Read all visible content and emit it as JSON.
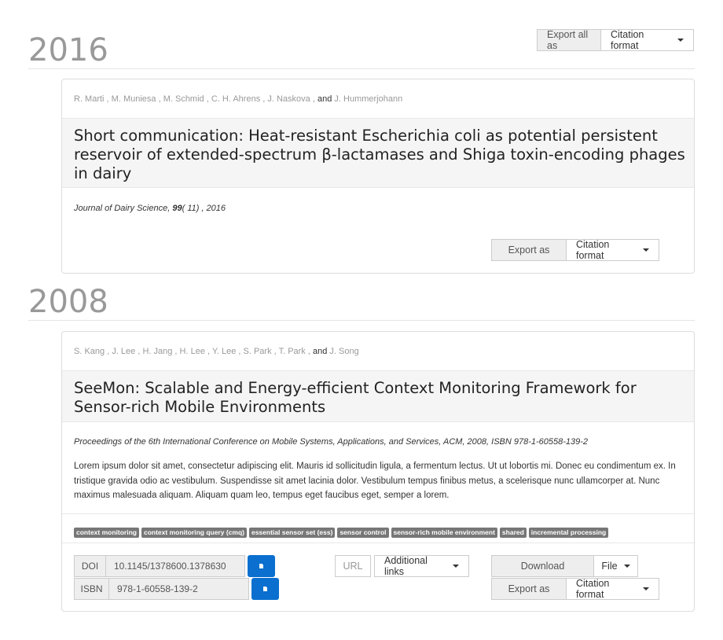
{
  "header": {
    "year": "2016",
    "export_all_label": "Export all as",
    "citation_format_label": "Citation format"
  },
  "pub1": {
    "authors": [
      "R. Marti",
      "M. Muniesa",
      "M. Schmid",
      "C. H. Ahrens",
      "J. Naskova"
    ],
    "and": "and",
    "last_author": "J. Hummerjohann",
    "title": "Short communication: Heat-resistant Escherichia coli as potential persistent reservoir of extended-spectrum β-lactamases and Shiga toxin-encoding phages in dairy",
    "journal": "Journal of Dairy Science,",
    "volume": "99",
    "issue_year": "( 11) , 2016",
    "export_label": "Export as",
    "citation_format_label": "Citation format"
  },
  "year2": "2008",
  "pub2": {
    "authors": [
      "S. Kang",
      "J. Lee",
      "H. Jang",
      "H. Lee",
      "Y. Lee",
      "S. Park",
      "T. Park"
    ],
    "and": "and",
    "last_author": "J. Song",
    "title": "SeeMon: Scalable and Energy-efficient Context Monitoring Framework for Sensor-rich Mobile Environments",
    "venue": "Proceedings of the 6th International Conference on Mobile Systems, Applications, and Services, ACM, 2008, ISBN 978-1-60558-139-2",
    "abstract": "Lorem ipsum dolor sit amet, consectetur adipiscing elit. Mauris id sollicitudin ligula, a fermentum lectus. Ut ut lobortis mi. Donec eu condimentum ex. In tristique gravida odio ac vestibulum. Suspendisse sit amet lacinia dolor. Vestibulum tempus finibus metus, a scelerisque nunc ullamcorper at. Nunc maximus malesuada aliquam. Aliquam quam leo, tempus eget faucibus eget, semper a lorem.",
    "tags": [
      "context monitoring",
      "context monitoring query (cmq)",
      "essential sensor set (ess)",
      "sensor control",
      "sensor-rich mobile environment",
      "shared",
      "incremental processing"
    ],
    "doi_label": "DOI",
    "doi_value": "10.1145/1378600.1378630",
    "isbn_label": "ISBN",
    "isbn_value": "978-1-60558-139-2",
    "url_label": "URL",
    "additional_links_label": "Additional links",
    "download_label": "Download",
    "file_label": "File",
    "export_label": "Export as",
    "citation_format_label": "Citation format"
  },
  "colors": {
    "accent": "#0a6fcf",
    "year": "#999999",
    "tag_bg": "#777777"
  }
}
